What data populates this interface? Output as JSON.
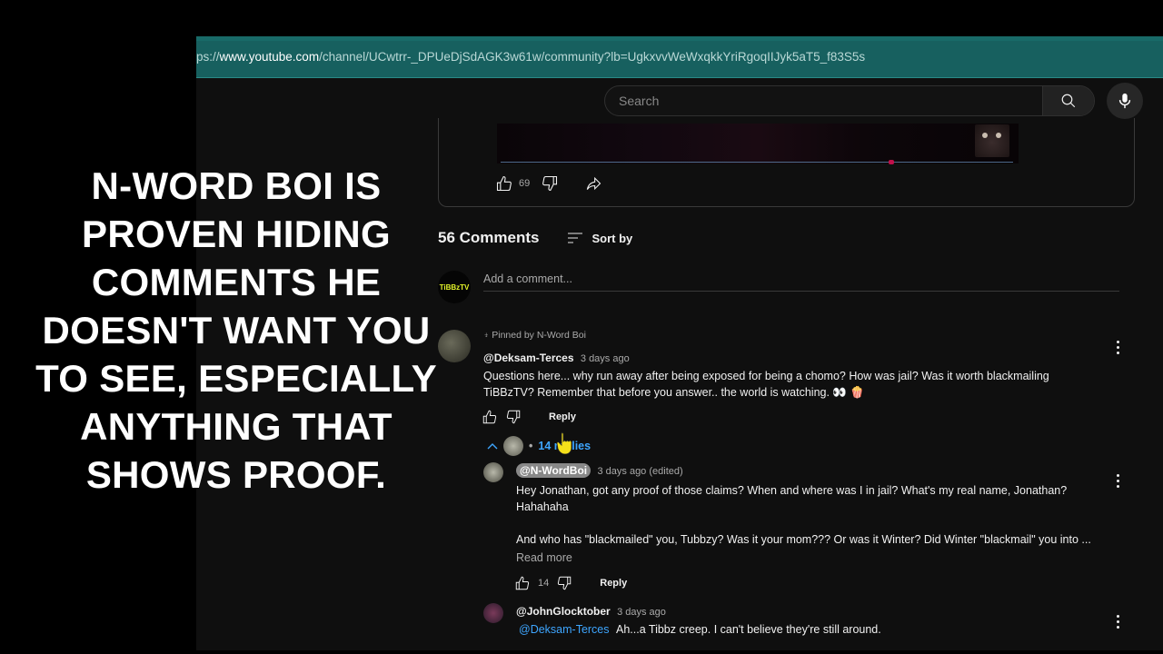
{
  "browser": {
    "url_prefix": "ps://",
    "url_host": "www.youtube.com",
    "url_path": "/channel/UCwtrr-_DPUeDjSdAGK3w61w/community?lb=UgkxvvWeWxqkkYriRgoqIIJyk5aT5_f83S5s"
  },
  "overlay": {
    "text": "N-WORD BOI IS PROVEN HIDING COMMENTS HE DOESN'T WANT YOU TO SEE, ESPECIALLY ANYTHING THAT SHOWS PROOF."
  },
  "header": {
    "search_placeholder": "Search",
    "search_icon": "search-icon",
    "mic_icon": "mic-icon"
  },
  "post": {
    "like_count": "69",
    "icons": [
      "thumbs-up-icon",
      "thumbs-down-icon",
      "share-icon"
    ]
  },
  "comments": {
    "count_label": "56 Comments",
    "sort_label": "Sort by",
    "self_avatar_text": "TiBBzTV",
    "add_placeholder": "Add a comment...",
    "pinned": {
      "pinned_label": "Pinned by N-Word Boi",
      "handle": "@Deksam-Terces",
      "time": "3 days ago",
      "text_line1": "Questions here... why run away after being exposed for being a chomo? How was jail? Was it worth blackmailing",
      "text_line2": "TiBBzTV? Remember that before you answer.. the world is watching. 👀 🍿",
      "reply_label": "Reply",
      "replies_label": "14 replies"
    },
    "replies": [
      {
        "handle": "@N-WordBoi",
        "time": "3 days ago (edited)",
        "is_owner": true,
        "text_line1": "Hey Jonathan, got any proof of those claims? When and where was I in jail? What's my real name, Jonathan?",
        "text_line2": "Hahahaha",
        "text_line3": "And who has \"blackmailed\" you, Tubbzy? Was it your mom??? Or was it Winter? Did Winter \"blackmail\" you into ...",
        "read_more": "Read more",
        "like_count": "14",
        "reply_label": "Reply"
      },
      {
        "handle": "@JohnGlocktober",
        "time": "3 days ago",
        "mention": "@Deksam-Terces",
        "text": "Ah...a Tibbz creep. I can't believe they're still around."
      }
    ]
  }
}
